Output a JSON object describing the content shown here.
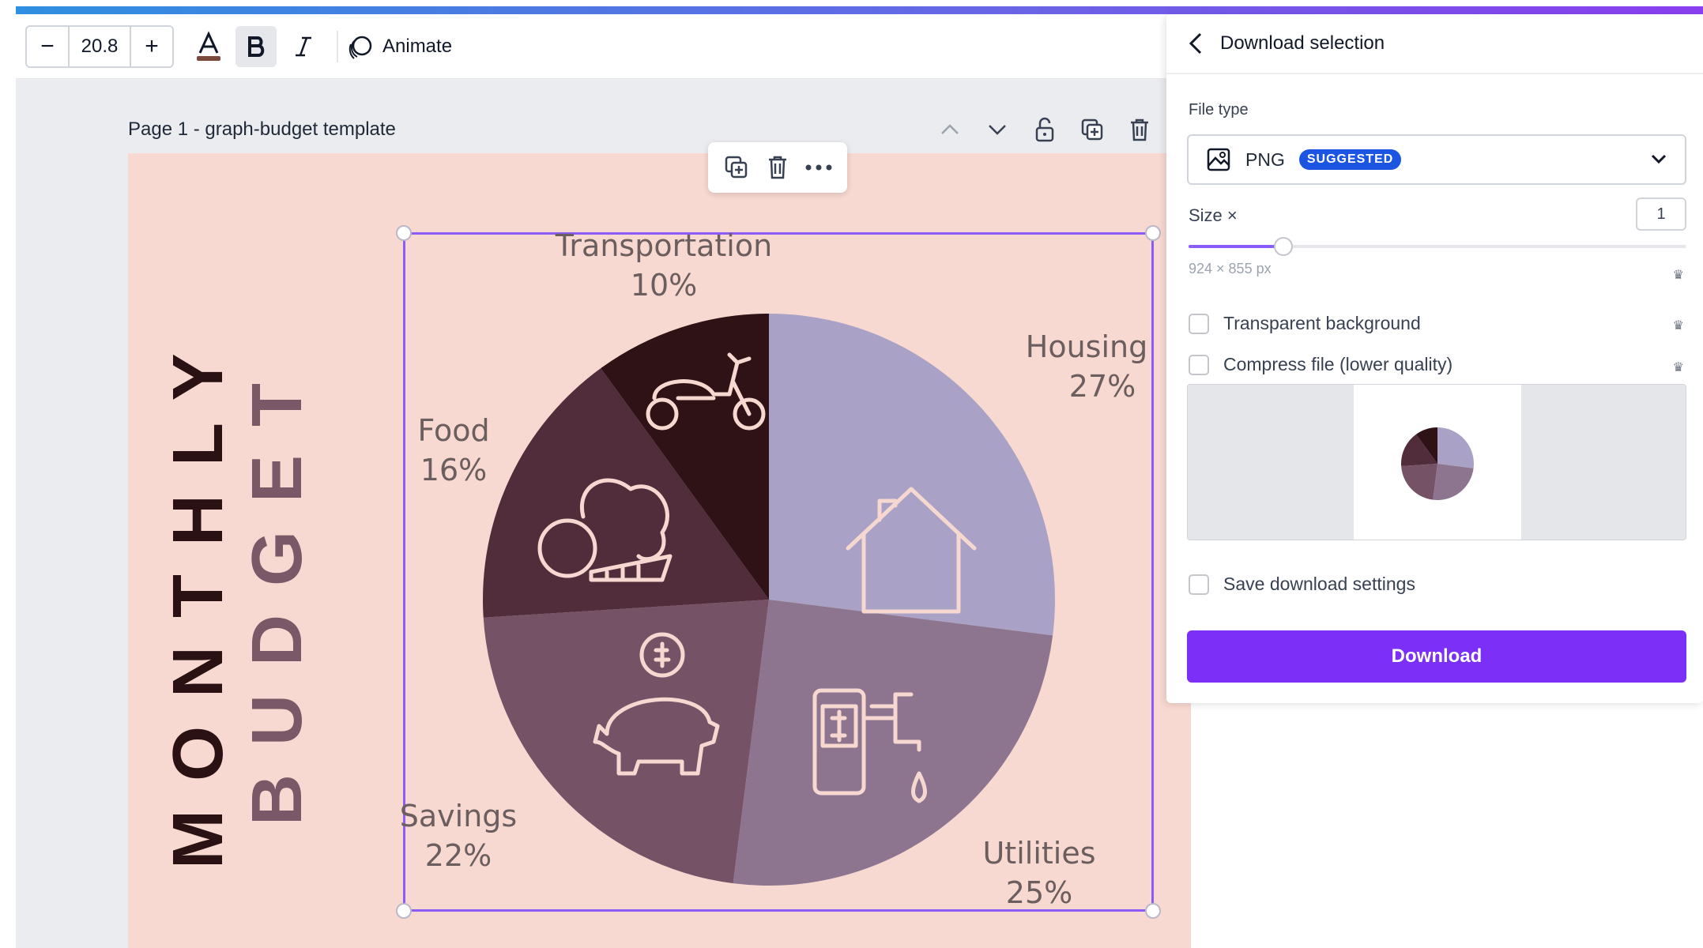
{
  "toolbar": {
    "font_size_value": "20.8",
    "decrease_label": "−",
    "increase_label": "+",
    "animate_label": "Animate",
    "icons": [
      "text-color-icon",
      "bold-icon",
      "italic-icon",
      "animate-icon"
    ]
  },
  "page": {
    "title": "Page 1 - graph-budget template",
    "actions": [
      "chevron-up-icon",
      "chevron-down-icon",
      "unlock-icon",
      "duplicate-page-icon",
      "delete-page-icon"
    ]
  },
  "floating_toolbar": {
    "icons": [
      "duplicate-icon",
      "delete-icon",
      "more-icon"
    ]
  },
  "design": {
    "title_line1": "MONTHLY",
    "title_line2": "BUDGET",
    "colors": {
      "background": "#f8d9d1",
      "title": "#2a1214",
      "subtitle": "#7a5868",
      "housing": "#a9a2c6",
      "utilities": "#8d7590",
      "savings": "#755266",
      "food": "#512c3a",
      "transportation": "#2e1216"
    }
  },
  "chart_data": {
    "type": "pie",
    "title": "",
    "categories": [
      "Housing",
      "Utilities",
      "Savings",
      "Food",
      "Transportation"
    ],
    "values": [
      27,
      25,
      22,
      16,
      10
    ],
    "value_labels": [
      "27%",
      "25%",
      "22%",
      "16%",
      "10%"
    ],
    "icons": [
      "house-icon",
      "utility-bill-icon",
      "piggy-bank-icon",
      "groceries-icon",
      "scooter-icon"
    ]
  },
  "panel": {
    "title": "Download selection",
    "file_type_label": "File type",
    "file_type_value": "PNG",
    "suggested_badge": "SUGGESTED",
    "size_label": "Size ×",
    "size_value": "1",
    "size_fraction": 0.19,
    "dimensions": "924 × 855 px",
    "options": [
      "Transparent background",
      "Compress file (lower quality)"
    ],
    "save_settings_label": "Save download settings",
    "download_label": "Download",
    "accent_color": "#7b2ff7"
  }
}
